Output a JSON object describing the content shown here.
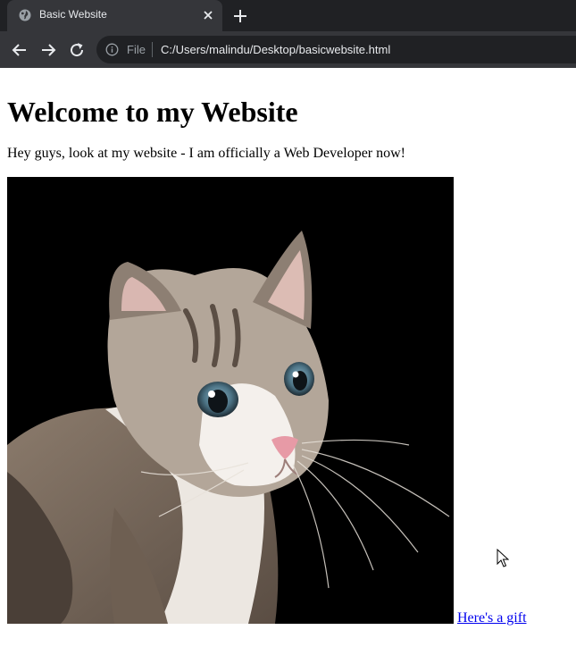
{
  "browser": {
    "tab_title": "Basic Website",
    "address_scheme": "File",
    "address_url": "C:/Users/malindu/Desktop/basicwebsite.html"
  },
  "page": {
    "heading": "Welcome to my Website",
    "intro": "Hey guys, look at my website - I am officially a Web Developer now!",
    "image": {
      "subject": "cat"
    },
    "link_text": "Here's a gift"
  },
  "colors": {
    "tabstrip": "#202124",
    "toolbar": "#35363a",
    "link": "#0000ee"
  }
}
